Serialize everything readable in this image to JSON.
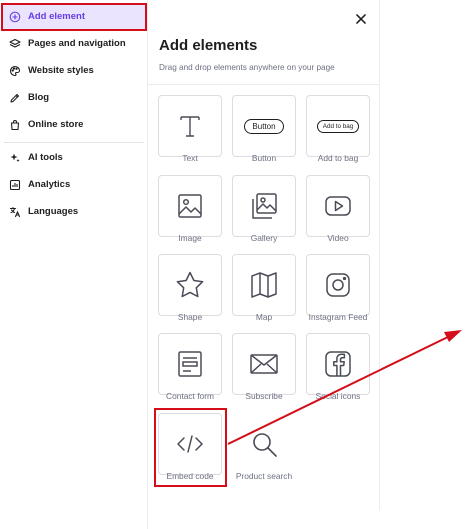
{
  "sidebar": {
    "items": [
      {
        "label": "Add element",
        "icon": "plus-circle-icon",
        "active": true
      },
      {
        "label": "Pages and navigation",
        "icon": "layers-icon"
      },
      {
        "label": "Website styles",
        "icon": "palette-icon"
      },
      {
        "label": "Blog",
        "icon": "pen-icon"
      },
      {
        "label": "Online store",
        "icon": "shopping-bag-icon"
      },
      {
        "label": "AI tools",
        "icon": "sparkles-icon"
      },
      {
        "label": "Analytics",
        "icon": "analytics-icon"
      },
      {
        "label": "Languages",
        "icon": "translate-icon"
      }
    ]
  },
  "panel": {
    "title": "Add elements",
    "subtitle": "Drag and drop elements anywhere on your page",
    "elements": [
      {
        "label": "Text",
        "icon": "text-icon"
      },
      {
        "label": "Button",
        "icon": "button-icon",
        "preview": "Button"
      },
      {
        "label": "Add to bag",
        "icon": "add-to-bag-icon",
        "preview": "Add to bag"
      },
      {
        "label": "Image",
        "icon": "image-icon"
      },
      {
        "label": "Gallery",
        "icon": "gallery-icon"
      },
      {
        "label": "Video",
        "icon": "video-icon"
      },
      {
        "label": "Shape",
        "icon": "star-icon"
      },
      {
        "label": "Map",
        "icon": "map-icon"
      },
      {
        "label": "Instagram Feed",
        "icon": "instagram-icon"
      },
      {
        "label": "Contact form",
        "icon": "form-icon"
      },
      {
        "label": "Subscribe",
        "icon": "envelope-icon"
      },
      {
        "label": "Social icons",
        "icon": "facebook-icon"
      },
      {
        "label": "Embed code",
        "icon": "code-icon"
      },
      {
        "label": "Product search",
        "icon": "search-icon"
      }
    ]
  },
  "colors": {
    "accent": "#673de6",
    "active_bg": "#ebe4ff",
    "annotation_red": "#d50d18"
  }
}
